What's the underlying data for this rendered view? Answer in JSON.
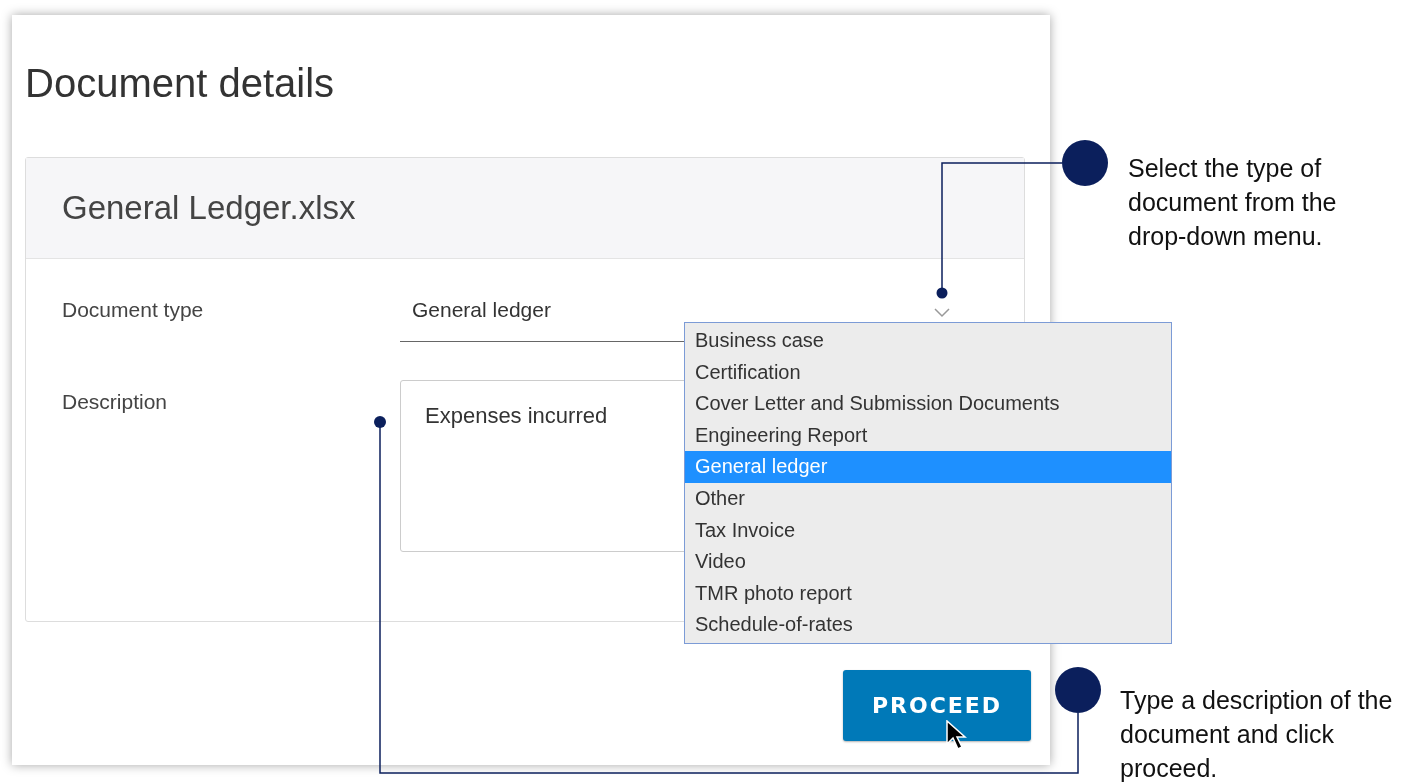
{
  "page": {
    "title": "Document details"
  },
  "file": {
    "name": "General Ledger.xlsx"
  },
  "fields": [
    {
      "kind": "select",
      "label": "Document type",
      "value": "General ledger",
      "expanded": true
    },
    {
      "kind": "textarea",
      "label": "Description",
      "value": "Expenses incurred"
    }
  ],
  "dropdown_options": [
    {
      "label": "Business case",
      "selected": false
    },
    {
      "label": "Certification",
      "selected": false
    },
    {
      "label": "Cover Letter and Submission Documents",
      "selected": false
    },
    {
      "label": "Engineering Report",
      "selected": false
    },
    {
      "label": "General ledger",
      "selected": true
    },
    {
      "label": "Other",
      "selected": false
    },
    {
      "label": "Tax Invoice",
      "selected": false
    },
    {
      "label": "Video",
      "selected": false
    },
    {
      "label": "TMR photo report",
      "selected": false
    },
    {
      "label": "Schedule-of-rates",
      "selected": false
    }
  ],
  "buttons": [
    {
      "label": "PROCEED"
    }
  ],
  "callouts": [
    {
      "text": "Select the type of document from the drop-down menu."
    },
    {
      "text": "Type a description of the document and click proceed."
    }
  ]
}
